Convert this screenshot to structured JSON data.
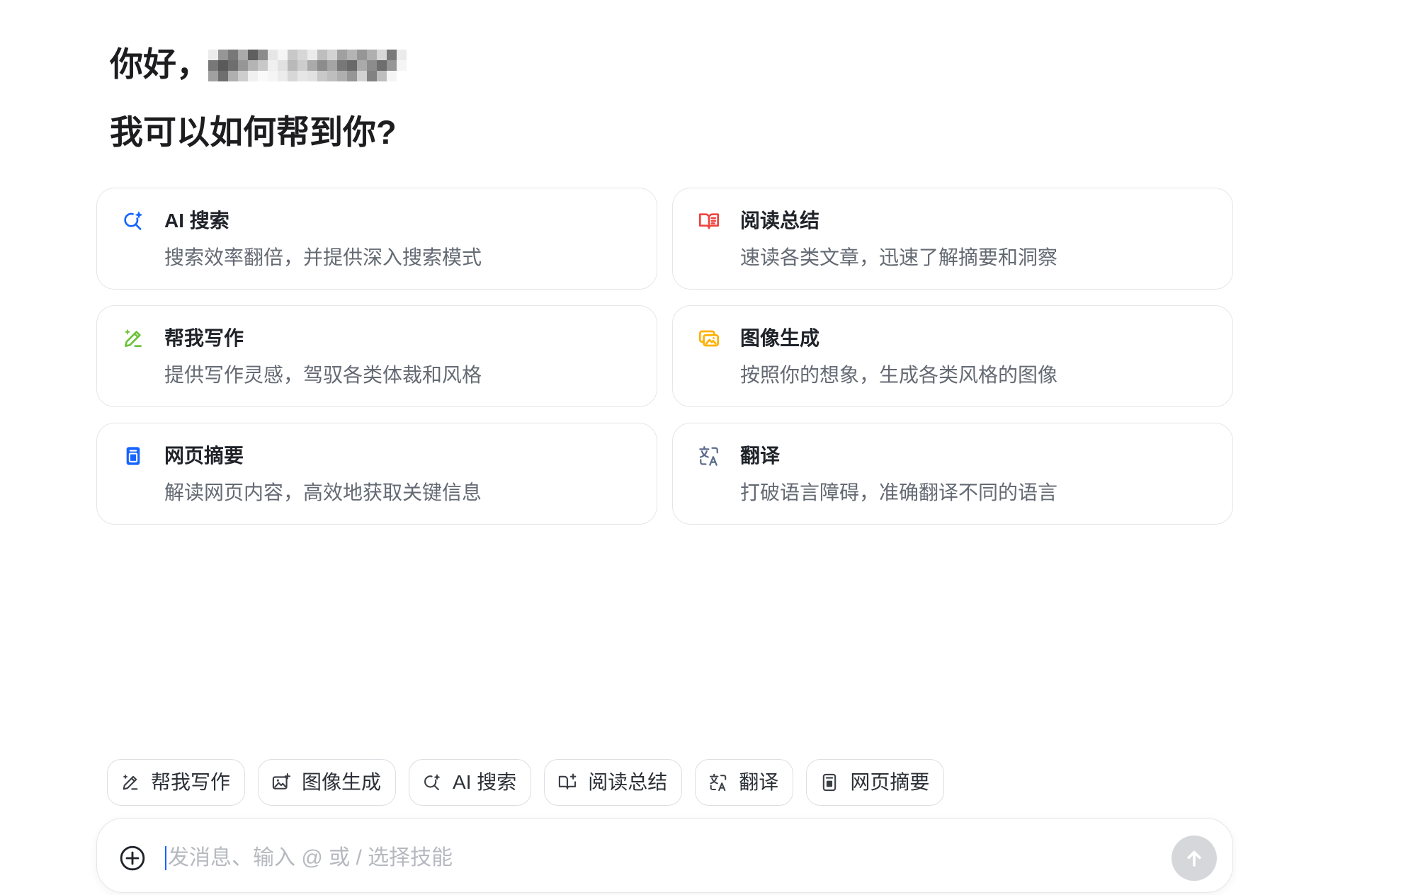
{
  "greeting": {
    "hello": "你好，",
    "question": "我可以如何帮到你?"
  },
  "skill_cards": [
    {
      "icon": "ai-search-icon",
      "icon_color": "#1664ff",
      "title": "AI 搜索",
      "description": "搜索效率翻倍，并提供深入搜索模式"
    },
    {
      "icon": "read-summary-icon",
      "icon_color": "#f0453f",
      "title": "阅读总结",
      "description": "速读各类文章，迅速了解摘要和洞察"
    },
    {
      "icon": "write-icon",
      "icon_color": "#6cc23a",
      "title": "帮我写作",
      "description": "提供写作灵感，驾驭各类体裁和风格"
    },
    {
      "icon": "image-generation-icon",
      "icon_color": "#ffb000",
      "title": "图像生成",
      "description": "按照你的想象，生成各类风格的图像"
    },
    {
      "icon": "web-summary-icon",
      "icon_color": "#1664ff",
      "title": "网页摘要",
      "description": "解读网页内容，高效地获取关键信息"
    },
    {
      "icon": "translate-icon",
      "icon_color": "#5b6b8c",
      "title": "翻译",
      "description": "打破语言障碍，准确翻译不同的语言"
    }
  ],
  "skill_chips": [
    {
      "icon": "write-icon",
      "label": "帮我写作"
    },
    {
      "icon": "image-generation-icon",
      "label": "图像生成"
    },
    {
      "icon": "ai-search-icon",
      "label": "AI 搜索"
    },
    {
      "icon": "read-summary-icon",
      "label": "阅读总结"
    },
    {
      "icon": "translate-icon",
      "label": "翻译"
    },
    {
      "icon": "web-summary-icon",
      "label": "网页摘要"
    }
  ],
  "composer": {
    "placeholder": "发消息、输入 @ 或 / 选择技能",
    "add_icon": "plus-circle-icon",
    "send_icon": "arrow-up-icon"
  },
  "colors": {
    "accent": "#1664ff",
    "text_primary": "#1f2329",
    "text_secondary": "#646a73",
    "placeholder": "#b6b9bf",
    "border": "#e4e6ea",
    "send_button_disabled": "#d6d7db"
  }
}
